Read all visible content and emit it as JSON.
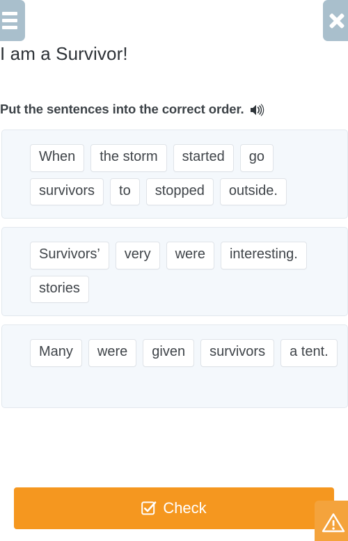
{
  "header": {
    "menu_icon": "hamburger-menu-icon",
    "close_icon": "close-x-icon",
    "accent_color": "#a9bfcc"
  },
  "page_title": "I am a Survivor!",
  "instruction": {
    "text": "Put the sentences into the correct order.",
    "audio_icon": "speaker-icon"
  },
  "cards": [
    {
      "id": "sentence-1",
      "chips": [
        "When",
        "the storm",
        "started",
        "go",
        "survivors",
        "to",
        "stopped",
        "outside."
      ]
    },
    {
      "id": "sentence-2",
      "chips": [
        "Survivors’",
        "very",
        "were",
        "interesting.",
        "stories"
      ]
    },
    {
      "id": "sentence-3",
      "chips": [
        "Many",
        "were",
        "given",
        "survivors",
        "a tent."
      ]
    }
  ],
  "check_button": {
    "label": "Check",
    "icon": "checked-box-icon",
    "color": "#f5971f"
  },
  "report_button": {
    "icon": "warning-triangle-icon",
    "color": "#f4a33c"
  },
  "colors": {
    "card_background": "#f4f8fc",
    "card_border": "#e2e8ee",
    "chip_background": "#ffffff",
    "chip_border": "#dfe3e8",
    "text": "#3f4449"
  }
}
